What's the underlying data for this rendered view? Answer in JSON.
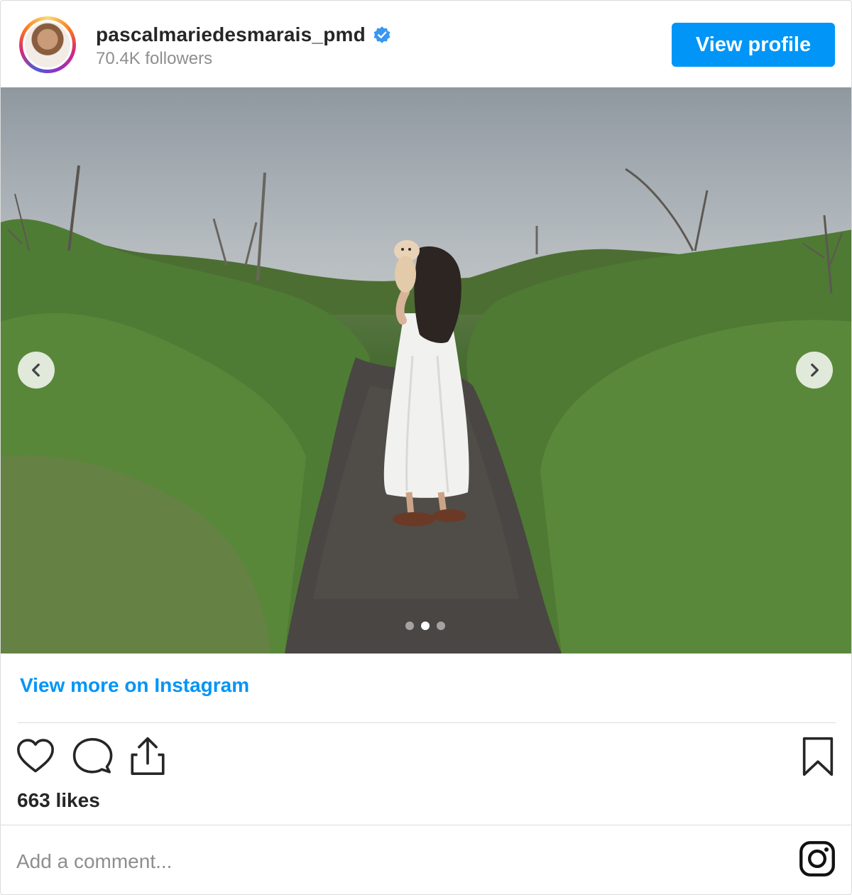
{
  "header": {
    "username": "pascalmariedesmarais_pmd",
    "verified": true,
    "followers": "70.4K followers",
    "view_profile_label": "View profile"
  },
  "carousel": {
    "slide_count": 3,
    "active_slide": 2,
    "prev_icon": "chevron-left",
    "next_icon": "chevron-right"
  },
  "links": {
    "view_more": "View more on Instagram"
  },
  "actions": {
    "icons": [
      "heart-icon",
      "comment-icon",
      "share-icon",
      "bookmark-icon"
    ],
    "likes": "663 likes"
  },
  "comment": {
    "placeholder": "Add a comment..."
  },
  "colors": {
    "accent": "#0095f6",
    "text": "#262626",
    "muted": "#8e8e8e",
    "border": "#dbdbdb"
  }
}
